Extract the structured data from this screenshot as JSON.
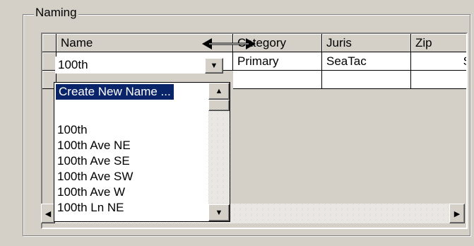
{
  "group": {
    "title": "Naming"
  },
  "grid": {
    "columns": [
      "Name",
      "Category",
      "Juris",
      "Zip"
    ],
    "row1": {
      "category": "Primary",
      "juris": "SeaTac",
      "zip_partial": "S"
    }
  },
  "combo": {
    "value": "100th"
  },
  "dropdown": {
    "selected": "Create New Name ...",
    "items": [
      "",
      "100th",
      "100th Ave NE",
      "100th Ave SE",
      "100th Ave SW",
      "100th Ave W",
      "100th Ln NE"
    ]
  },
  "icons": {
    "dropdown_arrow": "triangle-down",
    "scroll_up": "triangle-up",
    "scroll_down": "triangle-down",
    "scroll_left": "triangle-left",
    "scroll_right": "triangle-right",
    "resize_cursor": "horizontal-resize-arrow"
  },
  "colors": {
    "selection": "#0a246a",
    "face": "#d4d0c8"
  }
}
